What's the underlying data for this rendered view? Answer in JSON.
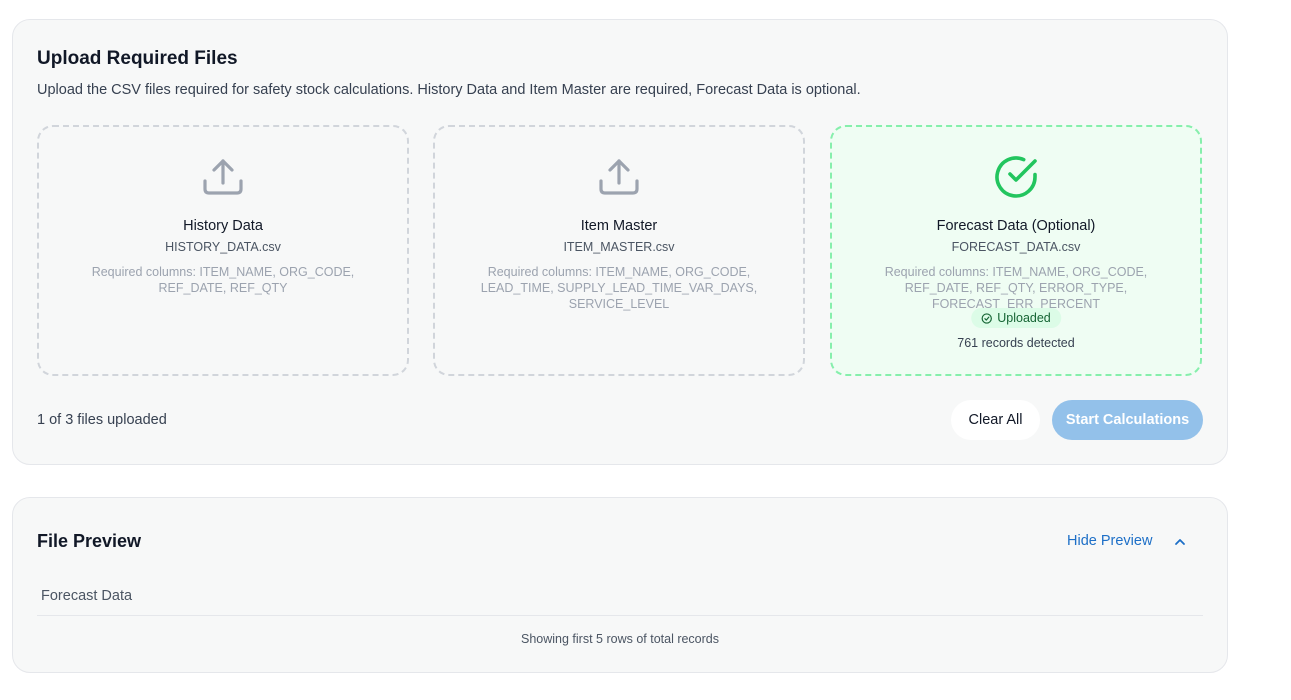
{
  "upload": {
    "title": "Upload Required Files",
    "description": "Upload the CSV files required for safety stock calculations. History Data and Item Master are required, Forecast Data is optional.",
    "dropzones": [
      {
        "name": "History Data",
        "file": "HISTORY_DATA.csv",
        "required": "Required columns: ITEM_NAME, ORG_CODE, REF_DATE, REF_QTY",
        "icon": "upload-icon",
        "status": "empty"
      },
      {
        "name": "Item Master",
        "file": "ITEM_MASTER.csv",
        "required": "Required columns: ITEM_NAME, ORG_CODE, LEAD_TIME, SUPPLY_LEAD_TIME_VAR_DAYS, SERVICE_LEVEL",
        "icon": "upload-icon",
        "status": "empty"
      },
      {
        "name": "Forecast Data (Optional)",
        "file": "FORECAST_DATA.csv",
        "required": "Required columns: ITEM_NAME, ORG_CODE, REF_DATE, REF_QTY, ERROR_TYPE, FORECAST_ERR_PERCENT",
        "icon": "check-circle-icon",
        "status": "uploaded",
        "badge": "Uploaded",
        "records": "761 records detected"
      }
    ],
    "count_text": "1 of 3 files uploaded",
    "clear_label": "Clear All",
    "start_label": "Start Calculations"
  },
  "preview": {
    "title": "File Preview",
    "toggle_label": "Hide Preview",
    "tab_label": "Forecast Data",
    "footer": "Showing first 5 rows of total records"
  },
  "colors": {
    "success": "#22c55e",
    "accent": "#1d6fc7",
    "start_button": "#93c1ea",
    "icon_gray": "#9ca3af"
  }
}
